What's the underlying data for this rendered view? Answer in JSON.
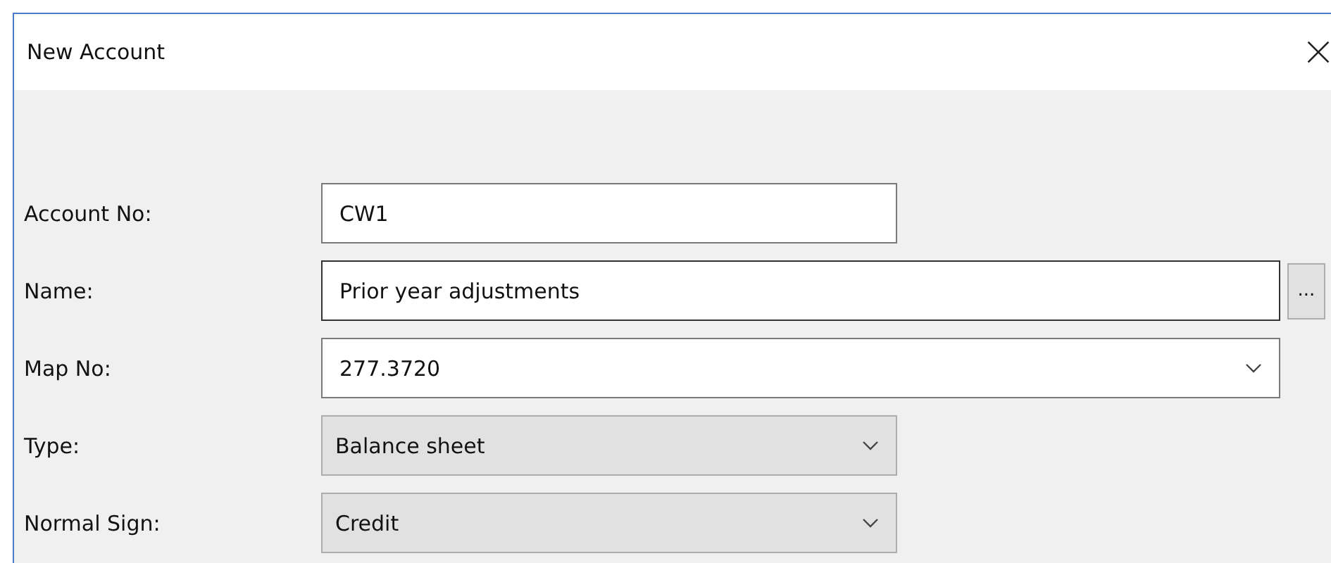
{
  "window": {
    "title": "New Account"
  },
  "fields": [
    {
      "label": "Account No:",
      "kind": "text",
      "value": "CW1",
      "wide": false
    },
    {
      "label": "Name:",
      "kind": "text",
      "value": "Prior year adjustments",
      "wide": true,
      "browse": "..."
    },
    {
      "label": "Map No:",
      "kind": "combo",
      "value": "277.3720",
      "wide": true
    },
    {
      "label": "Type:",
      "kind": "dropdown",
      "value": "Balance sheet",
      "wide": false
    },
    {
      "label": "Normal Sign:",
      "kind": "dropdown",
      "value": "Credit",
      "wide": false
    }
  ]
}
